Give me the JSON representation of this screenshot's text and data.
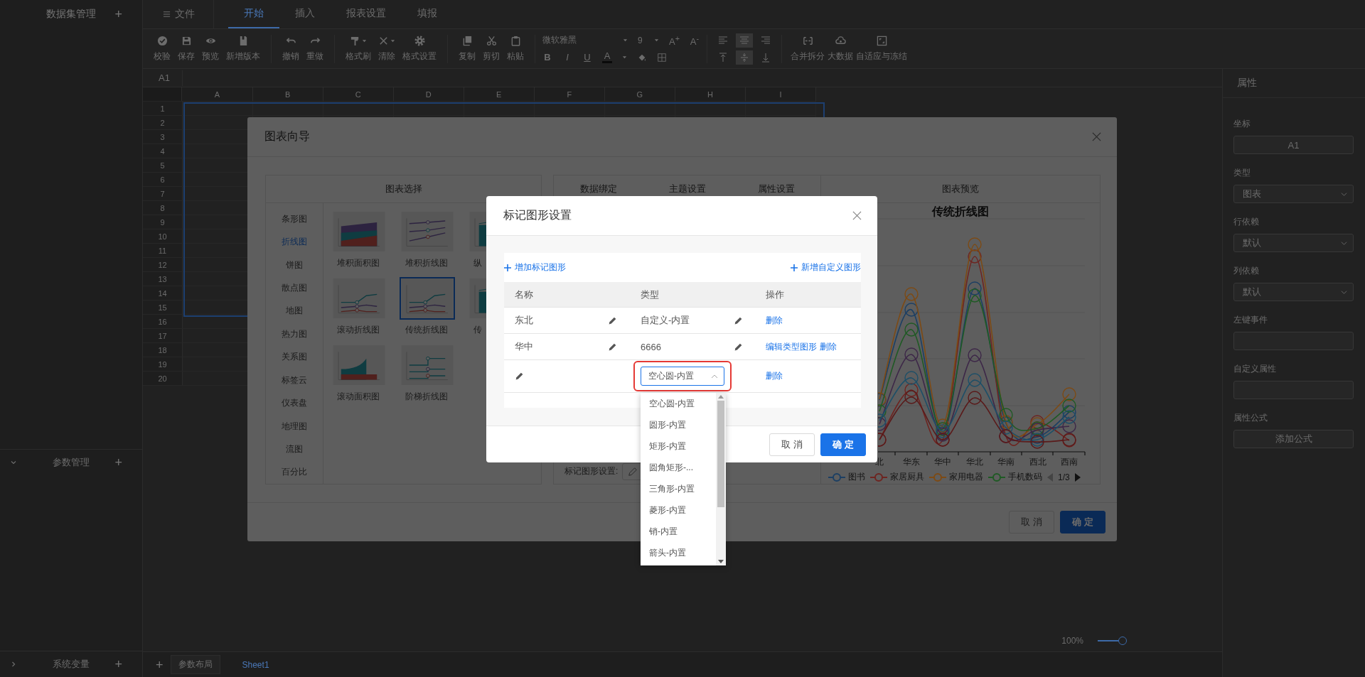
{
  "sidebar": {
    "title": "数据集管理",
    "add": "+",
    "sections": [
      {
        "label": "参数管理",
        "add": "+",
        "expanded": true
      },
      {
        "label": "系统变量",
        "add": "+",
        "expanded": false
      }
    ]
  },
  "tabs": [
    {
      "label": "文件",
      "kind": "menu",
      "selected": false
    },
    {
      "label": "开始",
      "kind": "tab",
      "selected": true
    },
    {
      "label": "插入",
      "kind": "tab",
      "selected": false
    },
    {
      "label": "报表设置",
      "kind": "tab",
      "selected": false
    },
    {
      "label": "填报",
      "kind": "tab",
      "selected": false
    }
  ],
  "toolbar": {
    "groups": [
      [
        {
          "label": "校验",
          "kind": "check",
          "menu": false
        },
        {
          "label": "保存",
          "kind": "save",
          "menu": false
        },
        {
          "label": "预览",
          "kind": "eye",
          "menu": false
        },
        {
          "label": "新增版本",
          "kind": "version",
          "menu": false
        }
      ],
      [
        {
          "label": "撤销",
          "kind": "undo",
          "menu": false
        },
        {
          "label": "重做",
          "kind": "redo",
          "menu": false
        }
      ],
      [
        {
          "label": "格式刷",
          "kind": "brush",
          "menu": true
        },
        {
          "label": "清除",
          "kind": "clear",
          "menu": true
        },
        {
          "label": "格式设置",
          "kind": "gear",
          "menu": false
        }
      ],
      [
        {
          "label": "复制",
          "kind": "copy",
          "menu": false
        },
        {
          "label": "剪切",
          "kind": "cut",
          "menu": false
        },
        {
          "label": "粘贴",
          "kind": "paste",
          "menu": false
        }
      ]
    ],
    "font": "微软雅黑",
    "font_size": "9",
    "grow": "A$^{+}$",
    "shrink": "A$^{-}$",
    "styles": [
      {
        "label": "B",
        "kind": "bold"
      },
      {
        "label": "I",
        "kind": "italic"
      },
      {
        "label": "U",
        "kind": "underline"
      },
      {
        "label": "A",
        "kind": "color"
      }
    ],
    "align": [
      {
        "kind": "left",
        "selected": false
      },
      {
        "kind": "center",
        "selected": true
      },
      {
        "kind": "right",
        "selected": false
      },
      {
        "kind": "top",
        "selected": false
      },
      {
        "kind": "middle",
        "selected": true
      },
      {
        "kind": "bottom",
        "selected": false
      }
    ],
    "actions": [
      {
        "label": "合并拆分",
        "kind": "merge"
      },
      {
        "label": "大数据",
        "kind": "cloud"
      },
      {
        "label": "自适应与冻结",
        "kind": "fit"
      }
    ]
  },
  "name_box": "A1",
  "sheet": {
    "columns": [
      "A",
      "B",
      "C",
      "D",
      "E",
      "F",
      "G",
      "H",
      "I"
    ],
    "rows": [
      "1",
      "2",
      "3",
      "4",
      "5",
      "6",
      "7",
      "8",
      "9",
      "10",
      "11",
      "12",
      "13",
      "14",
      "15",
      "16",
      "17",
      "18",
      "19",
      "20"
    ]
  },
  "zoom": {
    "label": "100%",
    "level": 0.85
  },
  "sheet_bar": {
    "add": "+",
    "tabs": [
      {
        "label": "参数布局",
        "selected": false
      },
      {
        "label": "Sheet1",
        "selected": true
      }
    ]
  },
  "properties": {
    "title": "属性",
    "fields": [
      {
        "label": "坐标",
        "kind": "readonly",
        "value": "A1"
      },
      {
        "label": "类型",
        "kind": "select",
        "value": "图表"
      },
      {
        "label": "行依赖",
        "kind": "select",
        "value": "默认"
      },
      {
        "label": "列依赖",
        "kind": "select",
        "value": "默认"
      },
      {
        "label": "左键事件",
        "kind": "input"
      },
      {
        "label": "自定义属性",
        "kind": "input"
      },
      {
        "label": "属性公式",
        "kind": "button",
        "value": "添加公式"
      }
    ]
  },
  "chart_wizard": {
    "title": "图表向导",
    "chart_select": {
      "title": "图表选择",
      "categories": [
        {
          "label": "条形图",
          "selected": false
        },
        {
          "label": "折线图",
          "selected": true
        },
        {
          "label": "饼图",
          "selected": false
        },
        {
          "label": "散点图",
          "selected": false
        },
        {
          "label": "地图",
          "selected": false
        },
        {
          "label": "热力图",
          "selected": false
        },
        {
          "label": "关系图",
          "selected": false
        },
        {
          "label": "标签云",
          "selected": false
        },
        {
          "label": "仪表盘",
          "selected": false
        },
        {
          "label": "地理图",
          "selected": false
        },
        {
          "label": "流图",
          "selected": false
        },
        {
          "label": "百分比",
          "selected": false
        }
      ],
      "charts": [
        {
          "label": "堆积面积图",
          "kind": "stacked-area",
          "selected": false
        },
        {
          "label": "堆积折线图",
          "kind": "stacked-line",
          "selected": false
        },
        {
          "label": "纵",
          "kind": "vertical-line",
          "selected": false
        },
        {
          "label": "滚动折线图",
          "kind": "scroll-line",
          "selected": false
        },
        {
          "label": "传统折线图",
          "kind": "line",
          "selected": true
        },
        {
          "label": "传",
          "kind": "bar-line",
          "selected": false
        },
        {
          "label": "滚动面积图",
          "kind": "scroll-area",
          "selected": false
        },
        {
          "label": "阶梯折线图",
          "kind": "step-line",
          "selected": false
        }
      ]
    },
    "settings": {
      "tabs": [
        "数据绑定",
        "主题设置",
        "属性设置"
      ],
      "marker_label": "标记图形设置:"
    },
    "preview": {
      "title": "图表预览",
      "chart_title": "传统折线图",
      "x_labels": [
        "北",
        "华东",
        "华中",
        "华北",
        "华南",
        "西北",
        "西南"
      ],
      "legend": [
        {
          "label": "图书",
          "color": "#1c3f63"
        },
        {
          "label": "家居厨具",
          "color": "#6e2420"
        },
        {
          "label": "家用电器",
          "color": "#7d4a14"
        },
        {
          "label": "手机数码",
          "color": "#1f5a24"
        }
      ],
      "legend_page": "1/3"
    },
    "buttons": [
      {
        "label": "取 消",
        "kind": "secondary"
      },
      {
        "label": "确 定",
        "kind": "primary"
      }
    ]
  },
  "marker_dialog": {
    "title": "标记图形设置",
    "add_link": "增加标记图形",
    "custom_link": "新增自定义图形",
    "columns": [
      "名称",
      "类型",
      "操作"
    ],
    "rows": [
      {
        "name": "东北",
        "type": "自定义-内置",
        "kind": "text",
        "highlighted": false,
        "actions": [
          "删除"
        ]
      },
      {
        "name": "华中",
        "type": "6666",
        "kind": "text",
        "highlighted": false,
        "actions": [
          "编辑类型图形",
          "删除"
        ]
      },
      {
        "type": "空心圆-内置",
        "kind": "select",
        "highlighted": true,
        "expanded": true,
        "actions": [
          "删除"
        ]
      }
    ],
    "options": [
      "空心圆-内置",
      "圆形-内置",
      "矩形-内置",
      "圆角矩形-...",
      "三角形-内置",
      "菱形-内置",
      "销-内置",
      "箭头-内置"
    ],
    "buttons": [
      {
        "label": "取 消",
        "kind": "secondary"
      },
      {
        "label": "确 定",
        "kind": "primary"
      }
    ]
  }
}
